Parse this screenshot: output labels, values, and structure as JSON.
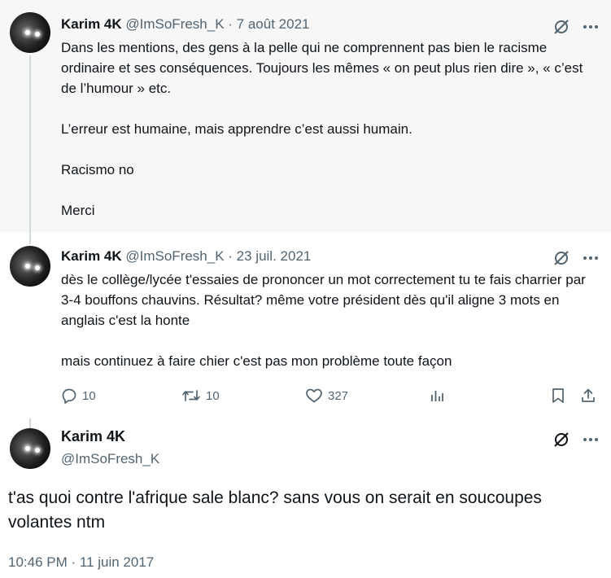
{
  "tweet1": {
    "name": "Karim 4K",
    "meta": "@ImSoFresh_K · 7 août 2021",
    "paragraphs": [
      "Dans les mentions, des gens à la pelle qui ne comprennent pas bien le racisme ordinaire et ses conséquences. Toujours les mêmes « on peut plus rien dire », « c’est de l’humour » etc.",
      "L’erreur est humaine, mais apprendre c’est aussi humain.",
      "Racismo no",
      "Merci"
    ]
  },
  "tweet2": {
    "name": "Karim 4K",
    "meta": "@ImSoFresh_K · 23 juil. 2021",
    "paragraphs": [
      "dès le collège/lycée t'essaies de prononcer un mot correctement tu te fais charrier par 3-4 bouffons chauvins. Résultat? même votre président dès qu'il aligne 3 mots en anglais c'est la honte",
      "mais continuez à faire chier c'est pas mon problème toute façon"
    ],
    "stats": {
      "replies": "10",
      "retweets": "10",
      "likes": "327"
    }
  },
  "tweet3": {
    "name": "Karim 4K",
    "handle": "@ImSoFresh_K",
    "text": "t'as quoi contre l'afrique sale blanc? sans vous on serait en soucoupes volantes ntm",
    "timestamp": "10:46 PM · 11 juin 2017"
  },
  "icons": {
    "grok": "grok-icon",
    "more": "more-icon",
    "reply": "reply-icon",
    "retweet": "retweet-icon",
    "like": "like-icon",
    "views": "views-icon",
    "bookmark": "bookmark-icon",
    "share": "share-icon"
  },
  "colors": {
    "text": "#0f1419",
    "secondary": "#536471",
    "thread_line": "#cfd9de",
    "highlight_bg": "#f7f7f7"
  }
}
